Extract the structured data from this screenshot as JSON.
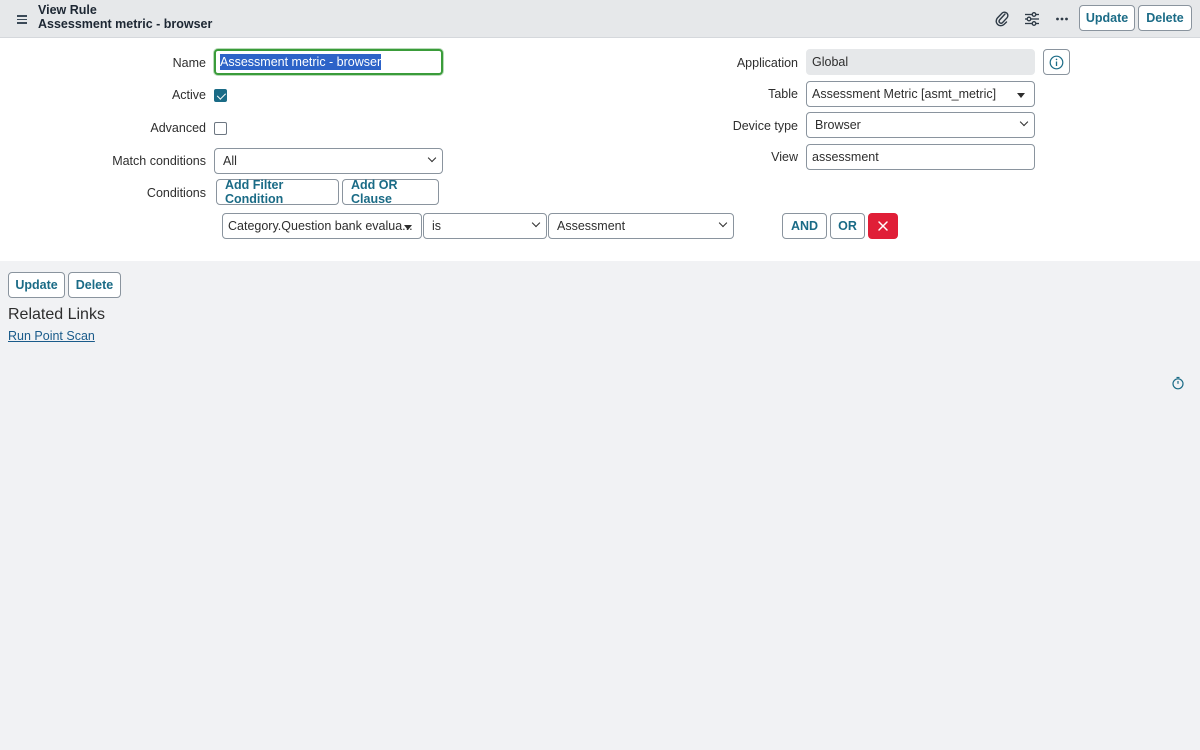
{
  "header": {
    "title": "View Rule",
    "subtitle": "Assessment metric - browser",
    "update_label": "Update",
    "delete_label": "Delete"
  },
  "form": {
    "name": {
      "label": "Name",
      "value": "Assessment metric - browser"
    },
    "active": {
      "label": "Active",
      "checked": true
    },
    "advanced": {
      "label": "Advanced",
      "checked": false
    },
    "match_conditions": {
      "label": "Match conditions",
      "value": "All"
    },
    "conditions": {
      "label": "Conditions",
      "add_filter_label": "Add Filter Condition",
      "add_or_label": "Add OR Clause",
      "field": "Category.Question bank evalua...",
      "operator": "is",
      "value": "Assessment",
      "and_label": "AND",
      "or_label": "OR"
    },
    "application": {
      "label": "Application",
      "value": "Global"
    },
    "table": {
      "label": "Table",
      "value": "Assessment Metric [asmt_metric]"
    },
    "device_type": {
      "label": "Device type",
      "value": "Browser"
    },
    "view": {
      "label": "View",
      "value": "assessment"
    }
  },
  "footer": {
    "update_label": "Update",
    "delete_label": "Delete"
  },
  "related_links": {
    "title": "Related Links",
    "items": [
      "Run Point Scan"
    ]
  },
  "colors": {
    "accent": "#1a6b86",
    "danger": "#e01e37",
    "focus": "#3a9c3a",
    "selection": "#2d63c8"
  }
}
